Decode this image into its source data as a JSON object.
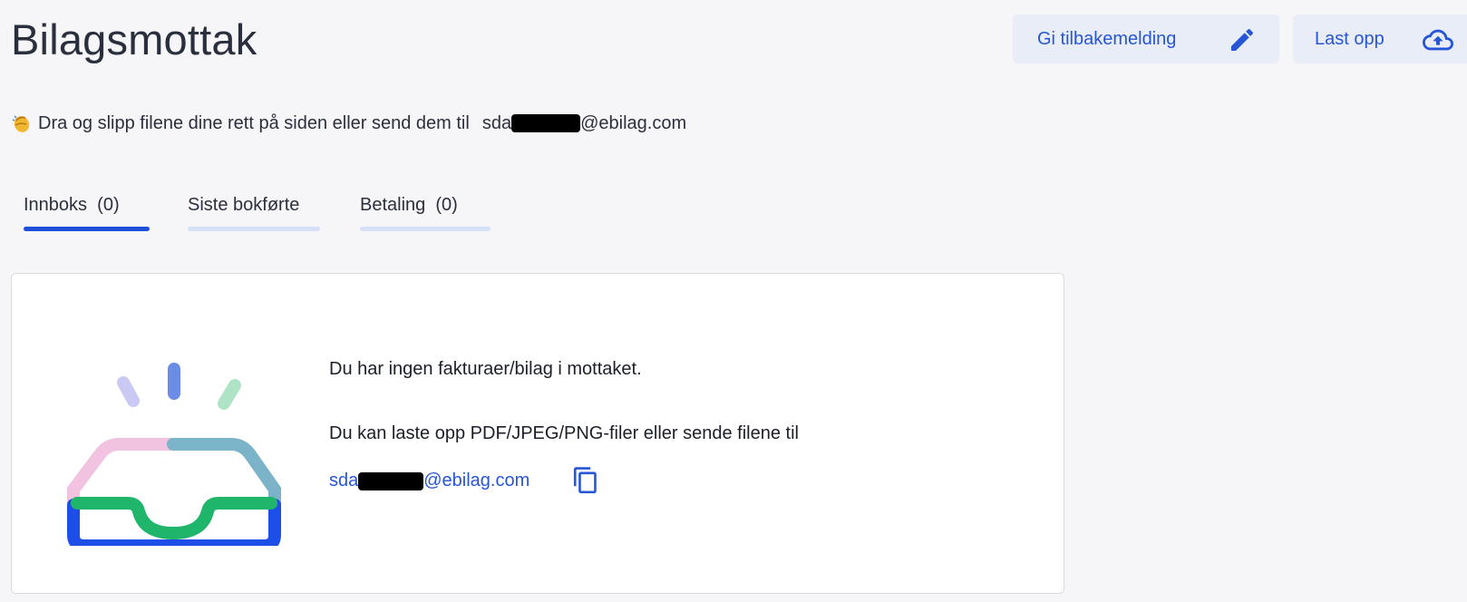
{
  "header": {
    "title": "Bilagsmottak",
    "feedback_label": "Gi tilbakemelding",
    "feedback_icon": "pencil-icon",
    "upload_label": "Last opp",
    "upload_icon": "cloud-upload-icon"
  },
  "hint": {
    "icon": "waving-hand-icon",
    "text": "Dra og slipp filene dine rett på siden eller send dem til",
    "email_prefix": "sda",
    "email_suffix": "@ebilag.com"
  },
  "tabs": [
    {
      "label": "Innboks  (0)",
      "active": true
    },
    {
      "label": "Siste bokførte",
      "active": false
    },
    {
      "label": "Betaling  (0)",
      "active": false
    }
  ],
  "empty_state": {
    "illustration": "inbox-tray-icon",
    "line1": "Du har ingen fakturaer/bilag i mottaket.",
    "line2": "Du kan laste opp PDF/JPEG/PNG-filer eller sende filene til",
    "email_prefix": "sda",
    "email_suffix": "@ebilag.com",
    "copy_icon": "copy-icon"
  },
  "colors": {
    "accent": "#2656d6",
    "tab_active": "#1f4fd8",
    "tab_inactive": "#d6e0f6",
    "button_bg": "#e8edf8"
  }
}
